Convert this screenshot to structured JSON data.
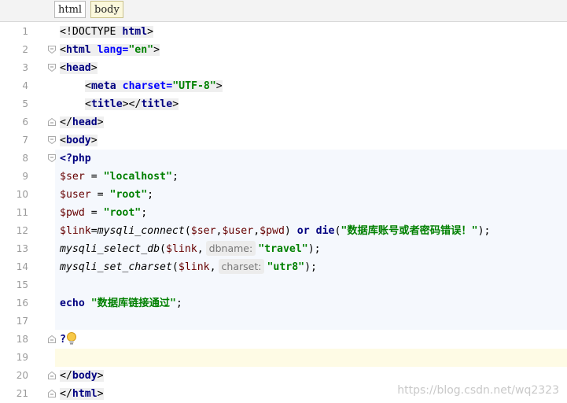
{
  "breadcrumb": {
    "items": [
      "html",
      "body"
    ]
  },
  "editor": {
    "line_numbers": [
      "1",
      "2",
      "3",
      "4",
      "5",
      "6",
      "7",
      "8",
      "9",
      "10",
      "11",
      "12",
      "13",
      "14",
      "15",
      "16",
      "17",
      "18",
      "19",
      "20",
      "21"
    ],
    "code": {
      "l1": {
        "doctype": "<!DOCTYPE ",
        "html": "html",
        "close": ">"
      },
      "l2": {
        "open": "<",
        "tag": "html",
        "attr": " lang=",
        "val": "\"en\"",
        "close": ">"
      },
      "l3": {
        "open": "<",
        "tag": "head",
        "close": ">"
      },
      "l4": {
        "open": "<",
        "tag": "meta",
        "attr": " charset=",
        "val": "\"UTF-8\"",
        "close": ">"
      },
      "l5": {
        "open": "<",
        "tag": "title",
        "mid": "></",
        "tag2": "title",
        "close": ">"
      },
      "l6": {
        "open": "</",
        "tag": "head",
        "close": ">"
      },
      "l7": {
        "open": "<",
        "tag": "body",
        "close": ">"
      },
      "l8": {
        "text": "<?php"
      },
      "l9": {
        "var": "$ser",
        "op": " = ",
        "val": "\"localhost\"",
        "end": ";"
      },
      "l10": {
        "var": "$user",
        "op": " = ",
        "val": "\"root\"",
        "end": ";"
      },
      "l11": {
        "var": "$pwd",
        "op": " = ",
        "val": "\"root\"",
        "end": ";"
      },
      "l12": {
        "var": "$link",
        "eq": "=",
        "fn": "mysqli_connect",
        "p1": "(",
        "a1": "$ser",
        "c1": ",",
        "a2": "$user",
        "c2": ",",
        "a3": "$pwd",
        "p2": ") ",
        "kw1": "or",
        "sp": " ",
        "kw2": "die",
        "p3": "(",
        "msg": "\"数据库账号或者密码错误！\"",
        "p4": ");"
      },
      "l13": {
        "fn": "mysqli_select_db",
        "p1": "(",
        "arg": "$link",
        "c1": ",",
        "hint": "dbname:",
        "val": "\"travel\"",
        "end": ");"
      },
      "l14": {
        "fn": "mysqli_set_charset",
        "p1": "(",
        "arg": "$link",
        "c1": ",",
        "hint": "charset:",
        "val": "\"utr8\"",
        "end": ");"
      },
      "l16": {
        "kw": "echo",
        "sp": " ",
        "val": "\"数据库链接通过\"",
        "end": ";"
      },
      "l18": {
        "text": "?"
      },
      "l20": {
        "open": "</",
        "tag": "body",
        "close": ">"
      },
      "l21": {
        "open": "</",
        "tag": "html",
        "close": ">"
      }
    }
  },
  "watermark": "https://blog.csdn.net/wq2323",
  "colors": {
    "tag": "#000080",
    "string": "#008000",
    "php_bg": "#f5f8fd",
    "current_line": "#fefbe5"
  }
}
